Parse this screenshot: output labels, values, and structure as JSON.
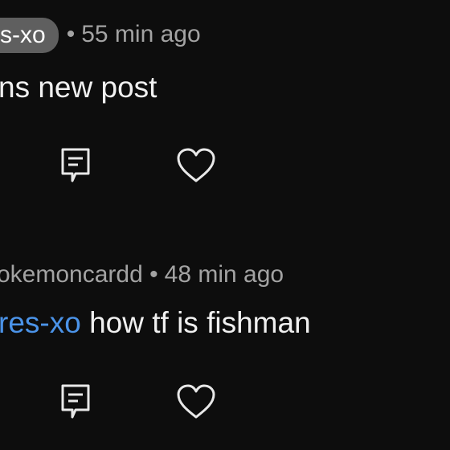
{
  "comments": [
    {
      "username": "s-xo",
      "time": "55 min ago",
      "body": "ns new post",
      "icons": {
        "reply": "reply-comment-icon",
        "like": "heart-icon"
      }
    },
    {
      "username": "okemoncardd",
      "time": "48 min ago",
      "mention": "res-xo",
      "body": " how tf is fishman",
      "icons": {
        "reply": "reply-comment-icon",
        "like": "heart-icon"
      }
    }
  ],
  "separator": "•",
  "colors": {
    "background": "#0d0d0d",
    "text": "#f0f0f0",
    "meta": "#a3a3a3",
    "pill": "#5f5f5f",
    "mention": "#4b93e8"
  }
}
